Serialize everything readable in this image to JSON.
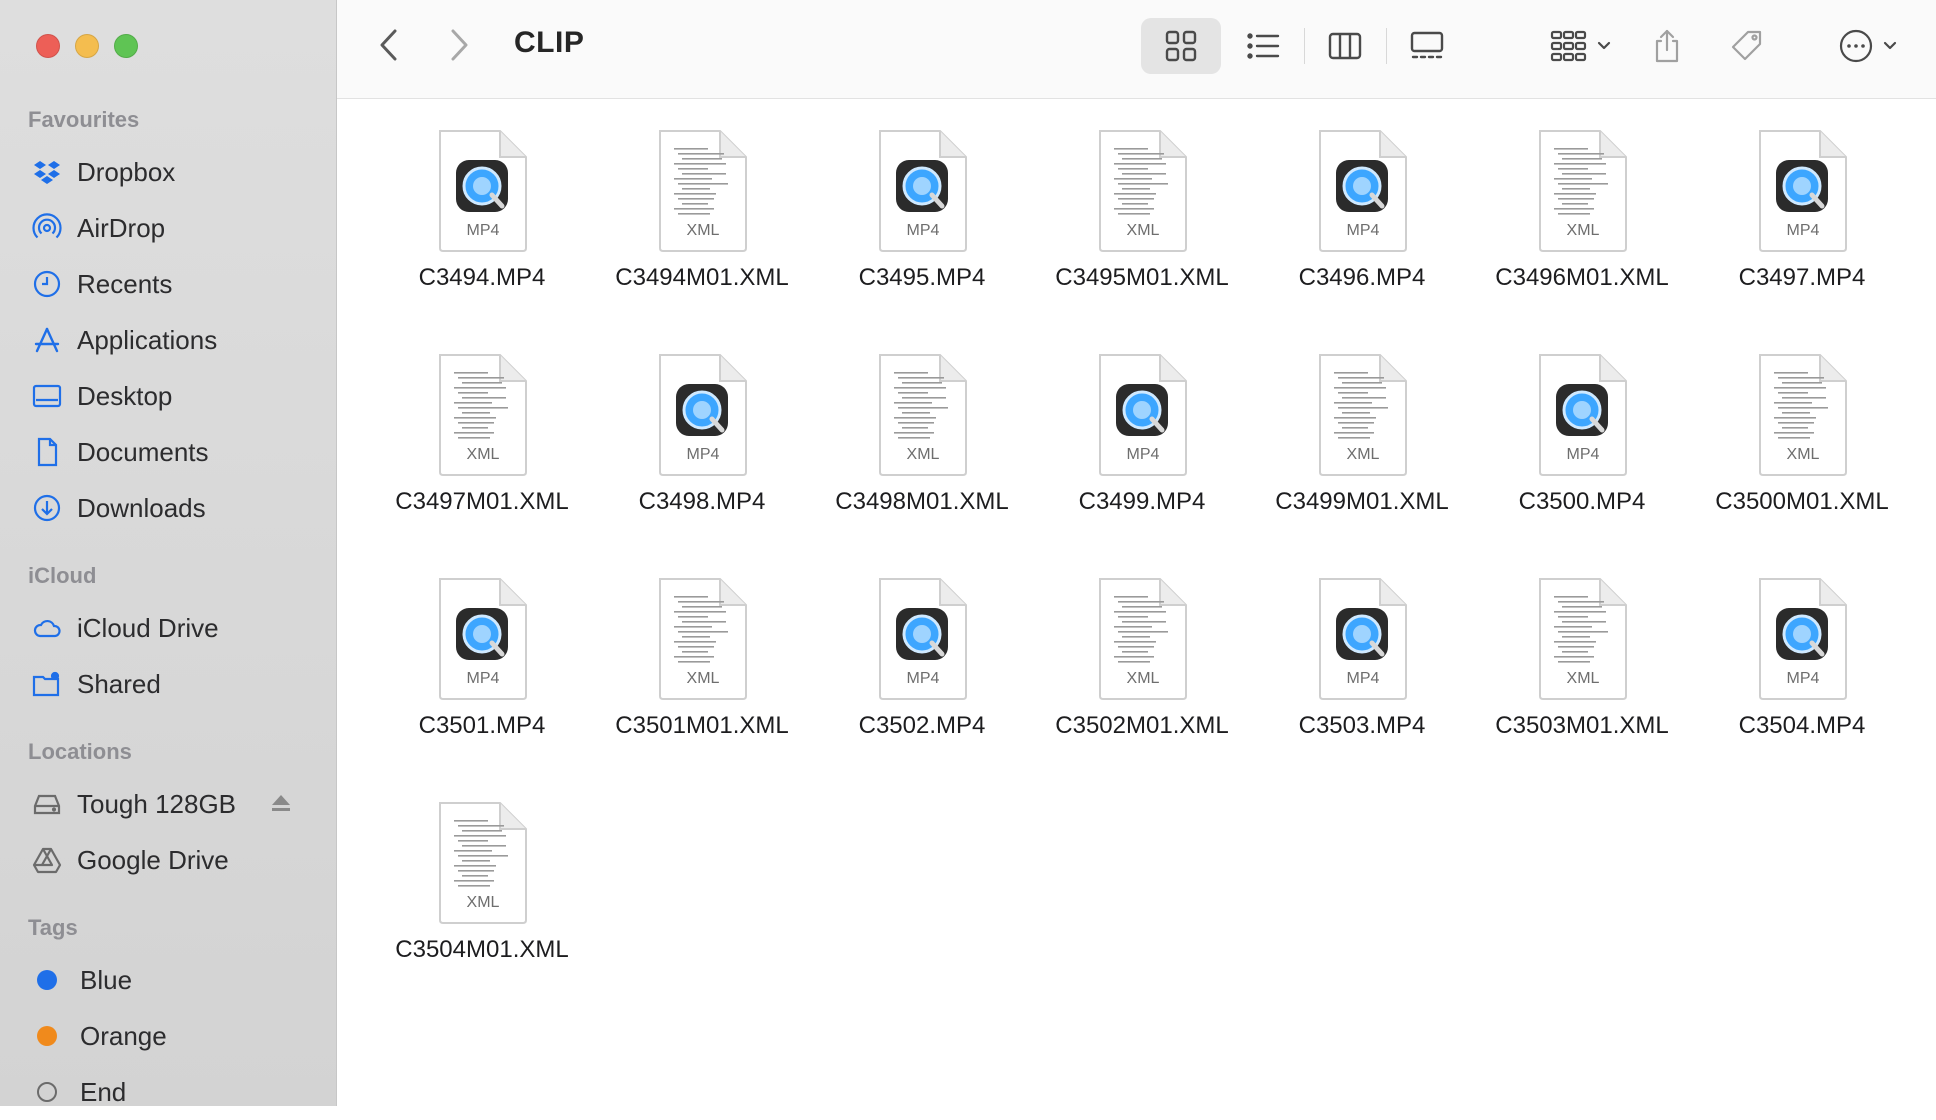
{
  "window": {
    "title": "CLIP"
  },
  "sidebar": {
    "favourites_title": "Favourites",
    "favourites": [
      {
        "label": "Dropbox",
        "icon": "dropbox-icon"
      },
      {
        "label": "AirDrop",
        "icon": "airdrop-icon"
      },
      {
        "label": "Recents",
        "icon": "clock-icon"
      },
      {
        "label": "Applications",
        "icon": "applications-icon"
      },
      {
        "label": "Desktop",
        "icon": "desktop-icon"
      },
      {
        "label": "Documents",
        "icon": "document-icon"
      },
      {
        "label": "Downloads",
        "icon": "download-icon"
      }
    ],
    "icloud_title": "iCloud",
    "icloud": [
      {
        "label": "iCloud Drive",
        "icon": "cloud-icon"
      },
      {
        "label": "Shared",
        "icon": "shared-folder-icon"
      }
    ],
    "locations_title": "Locations",
    "locations": [
      {
        "label": "Tough 128GB",
        "icon": "drive-icon"
      },
      {
        "label": "Google Drive",
        "icon": "google-drive-icon"
      }
    ],
    "tags_title": "Tags",
    "tags": [
      {
        "label": "Blue",
        "color": "#1f6fe8"
      },
      {
        "label": "Orange",
        "color": "#f08a1c"
      },
      {
        "label": "End",
        "color": "none"
      }
    ]
  },
  "files": [
    {
      "name": "C3494.MP4",
      "type": "MP4"
    },
    {
      "name": "C3494M01.XML",
      "type": "XML"
    },
    {
      "name": "C3495.MP4",
      "type": "MP4"
    },
    {
      "name": "C3495M01.XML",
      "type": "XML"
    },
    {
      "name": "C3496.MP4",
      "type": "MP4"
    },
    {
      "name": "C3496M01.XML",
      "type": "XML"
    },
    {
      "name": "C3497.MP4",
      "type": "MP4"
    },
    {
      "name": "C3497M01.XML",
      "type": "XML"
    },
    {
      "name": "C3498.MP4",
      "type": "MP4"
    },
    {
      "name": "C3498M01.XML",
      "type": "XML"
    },
    {
      "name": "C3499.MP4",
      "type": "MP4"
    },
    {
      "name": "C3499M01.XML",
      "type": "XML"
    },
    {
      "name": "C3500.MP4",
      "type": "MP4"
    },
    {
      "name": "C3500M01.XML",
      "type": "XML"
    },
    {
      "name": "C3501.MP4",
      "type": "MP4"
    },
    {
      "name": "C3501M01.XML",
      "type": "XML"
    },
    {
      "name": "C3502.MP4",
      "type": "MP4"
    },
    {
      "name": "C3502M01.XML",
      "type": "XML"
    },
    {
      "name": "C3503.MP4",
      "type": "MP4"
    },
    {
      "name": "C3503M01.XML",
      "type": "XML"
    },
    {
      "name": "C3504.MP4",
      "type": "MP4"
    },
    {
      "name": "C3504M01.XML",
      "type": "XML"
    }
  ],
  "colors": {
    "accent": "#1f6fe8",
    "sidebar_bg": "#d9d9d9"
  }
}
